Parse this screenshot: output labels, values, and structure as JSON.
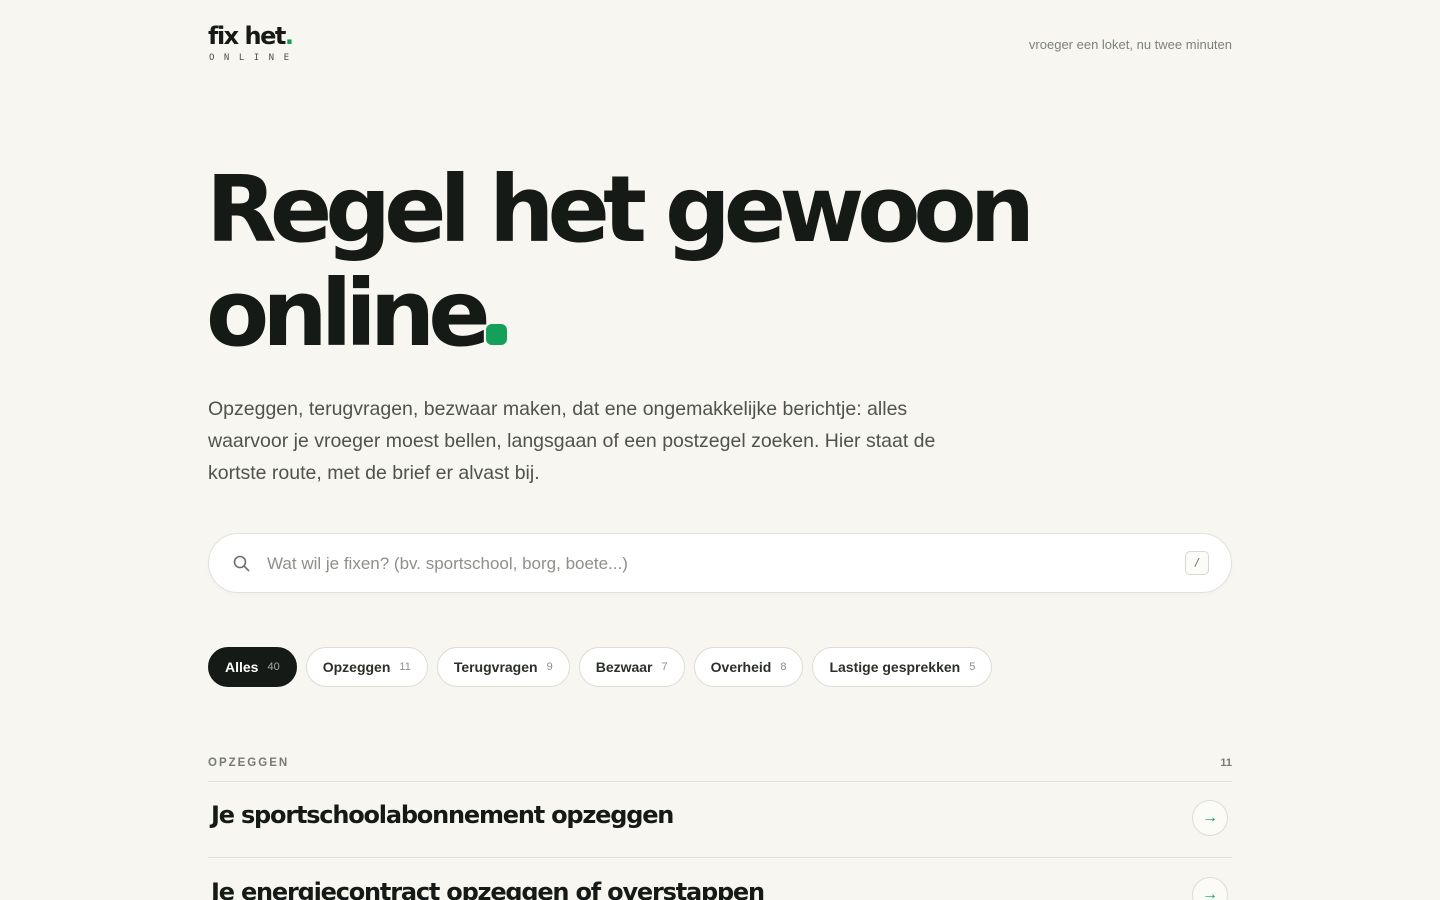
{
  "header": {
    "logo_text": "fix het",
    "logo_dot": ".",
    "logo_subtitle": "ONLINE",
    "tagline": "vroeger een loket, nu twee minuten"
  },
  "hero": {
    "title_line1": "Regel het gewoon",
    "title_line2": "online",
    "intro": "Opzeggen, terugvragen, bezwaar maken, dat ene ongemakkelijke berichtje: alles waarvoor je vroeger moest bellen, langsgaan of een postzegel zoeken. Hier staat de kortste route, met de brief er alvast bij."
  },
  "search": {
    "placeholder": "Wat wil je fixen? (bv. sportschool, borg, boete...)",
    "value": "",
    "shortcut": "/"
  },
  "filters": [
    {
      "label": "Alles",
      "count": "40",
      "active": true
    },
    {
      "label": "Opzeggen",
      "count": "11",
      "active": false
    },
    {
      "label": "Terugvragen",
      "count": "9",
      "active": false
    },
    {
      "label": "Bezwaar",
      "count": "7",
      "active": false
    },
    {
      "label": "Overheid",
      "count": "8",
      "active": false
    },
    {
      "label": "Lastige gesprekken",
      "count": "5",
      "active": false
    }
  ],
  "section": {
    "label": "OPZEGGEN",
    "count": "11",
    "items": [
      {
        "title": "Je sportschoolabonnement opzeggen",
        "arrow": "→"
      },
      {
        "title": "Je energiecontract opzeggen of overstappen",
        "arrow": "→"
      }
    ]
  },
  "colors": {
    "accent": "#15a05a",
    "ink": "#161a16",
    "background": "#f7f6f1"
  }
}
